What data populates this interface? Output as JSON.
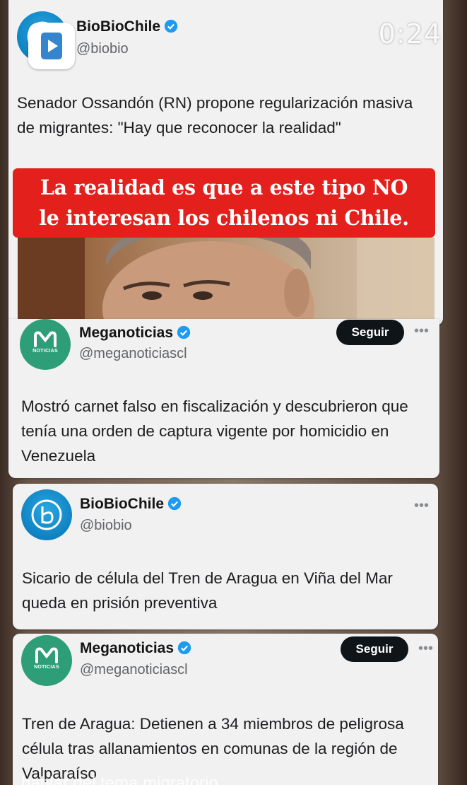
{
  "story": {
    "timer": "0:24",
    "bottom_overlay_text": "hablar del tema migratorio"
  },
  "tweets": [
    {
      "account_name": "BioBioChile",
      "handle": "@biobio",
      "text": "Senador Ossandón (RN) propone regularización masiva de migrantes: \"Hay que reconocer la realidad\"",
      "verified": true
    },
    {
      "account_name": "Meganoticias",
      "handle": "@meganoticiascl",
      "logo_label": "NOTICIAS",
      "follow_label": "Seguir",
      "text": "Mostró carnet falso en fiscalización y descubrieron que tenía una orden de captura vigente por homicidio en Venezuela",
      "verified": true
    },
    {
      "account_name": "BioBioChile",
      "handle": "@biobio",
      "text": "Sicario de célula del Tren de Aragua en Viña del Mar queda en prisión preventiva",
      "verified": true
    },
    {
      "account_name": "Meganoticias",
      "handle": "@meganoticiascl",
      "logo_label": "NOTICIAS",
      "follow_label": "Seguir",
      "text": "Tren de Aragua: Detienen a 34 miembros de peligrosa célula tras allanamientos en comunas de la región de Valparaíso",
      "verified": true
    }
  ],
  "banner": {
    "line1": "La realidad es que a este tipo NO",
    "line2": "le interesan los chilenos ni Chile."
  },
  "colors": {
    "banner_red": "#e3201b",
    "verified_blue": "#1d9bf0",
    "biobio_blue": "#0e7fc0",
    "mega_green": "#2e9e78",
    "follow_button_bg": "#0f1419"
  }
}
